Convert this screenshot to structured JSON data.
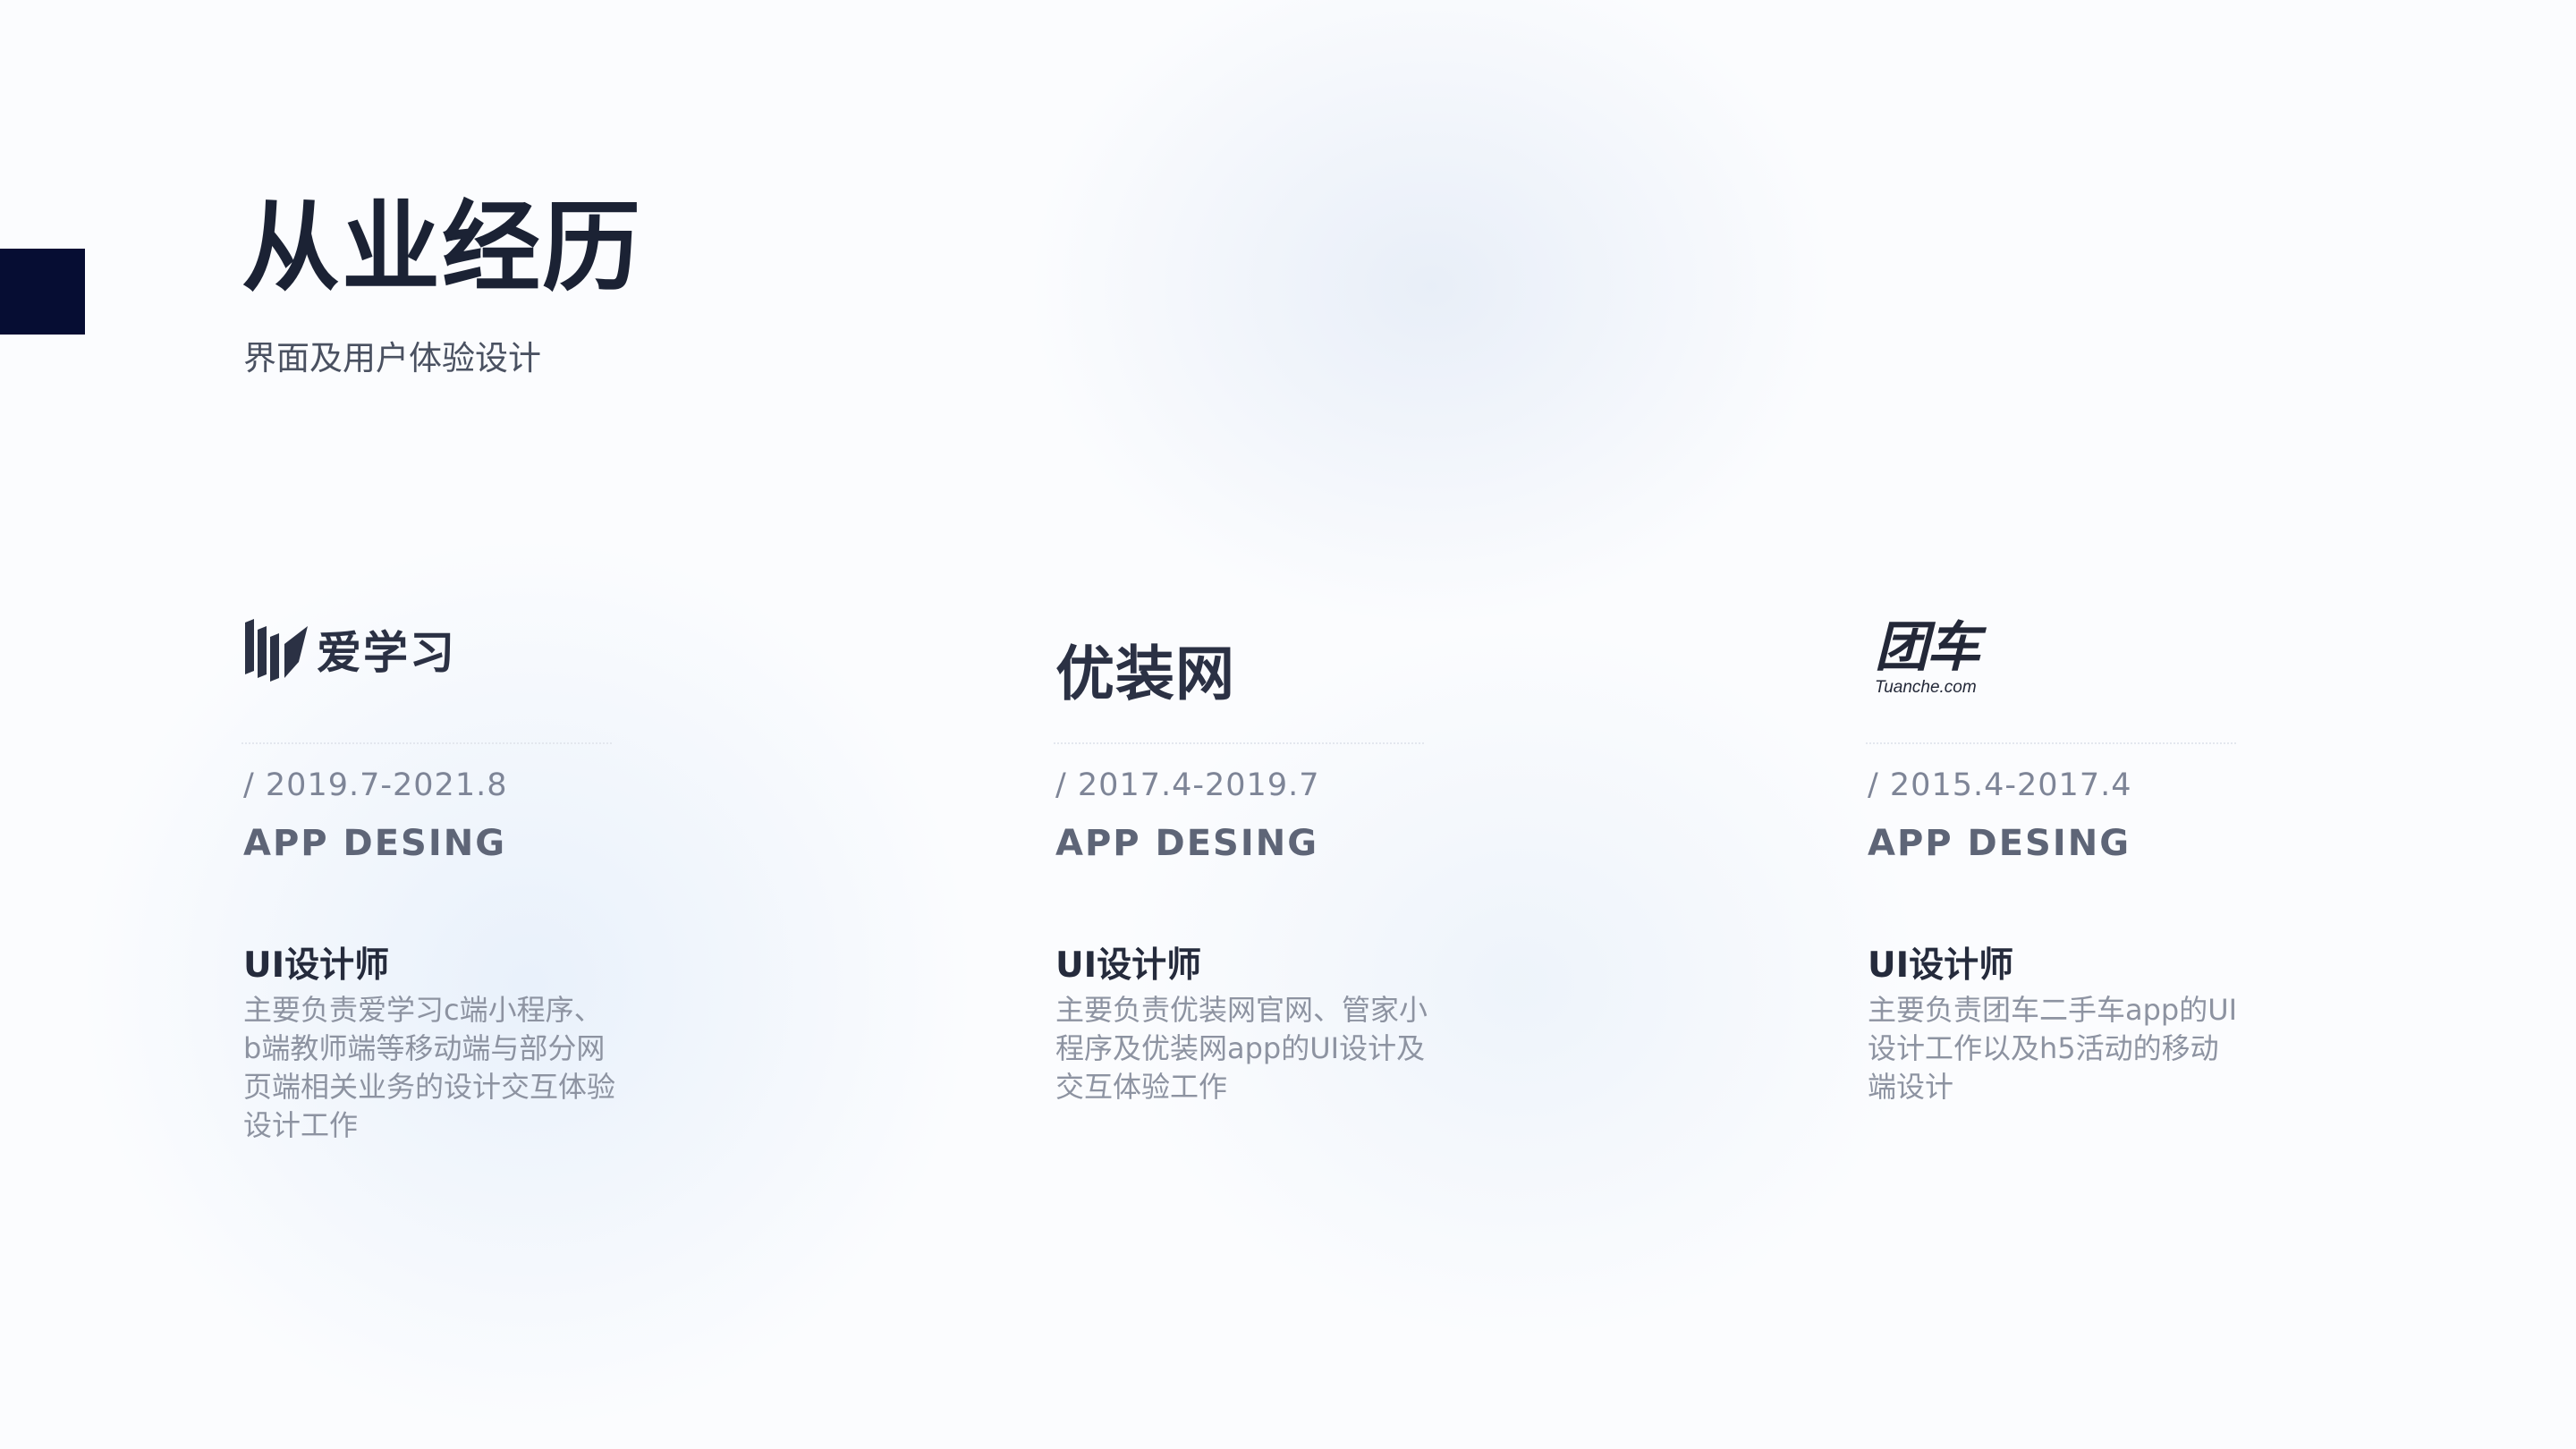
{
  "header": {
    "title": "从业经历",
    "subtitle": "界面及用户体验设计"
  },
  "experiences": [
    {
      "logo_text": "爱学习",
      "period": "/ 2019.7-2021.8",
      "category": "APP DESING",
      "role": "UI设计师",
      "description": "主要负责爱学习c端小程序、b端教师端等移动端与部分网页端相关业务的设计交互体验设计工作"
    },
    {
      "logo_text": "优装网",
      "period": "/ 2017.4-2019.7",
      "category": "APP DESING",
      "role": "UI设计师",
      "description": "主要负责优装网官网、管家小程序及优装网app的UI设计及交互体验工作"
    },
    {
      "logo_text": "团车",
      "logo_subtext": "Tuanche.com",
      "period": "/ 2015.4-2017.4",
      "category": "APP DESING",
      "role": "UI设计师",
      "description": "主要负责团车二手车app的UI设计工作以及h5活动的移动端设计"
    }
  ],
  "colors": {
    "accent_block": "#060d33",
    "title": "#1b2234",
    "body_text": "#8d93a1"
  }
}
